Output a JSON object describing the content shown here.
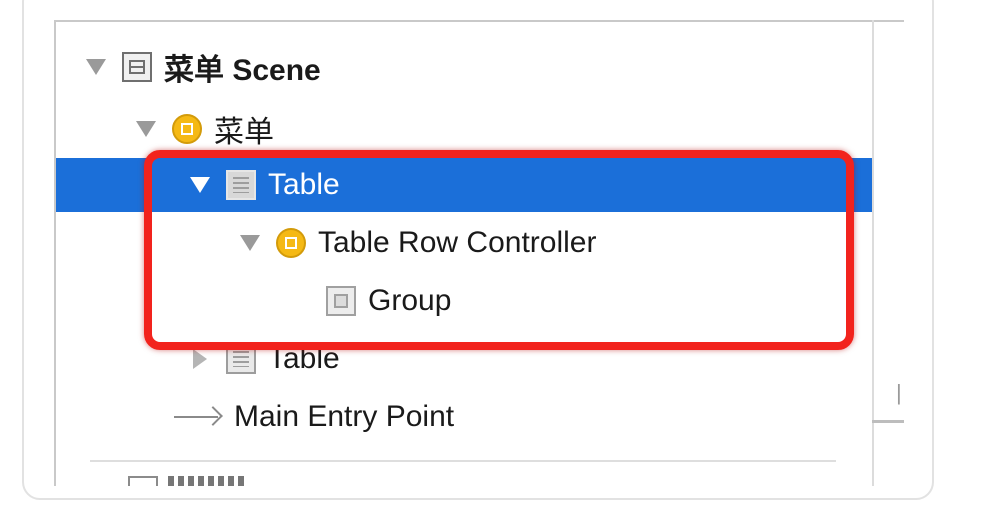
{
  "outline": {
    "scene_label": "菜单 Scene",
    "controller_label": "菜单",
    "table_label": "Table",
    "row_controller_label": "Table Row Controller",
    "group_label": "Group",
    "table2_label": "Table",
    "entry_label": "Main Entry Point"
  },
  "colors": {
    "selection": "#1b6fd9",
    "highlight_border": "#f2231d",
    "controller_icon": "#f5b914"
  },
  "icons": {
    "scene": "scene-icon",
    "controller": "interface-controller-icon",
    "table": "table-icon",
    "row_controller": "row-controller-icon",
    "group": "group-icon",
    "entry": "arrow-right-icon"
  }
}
